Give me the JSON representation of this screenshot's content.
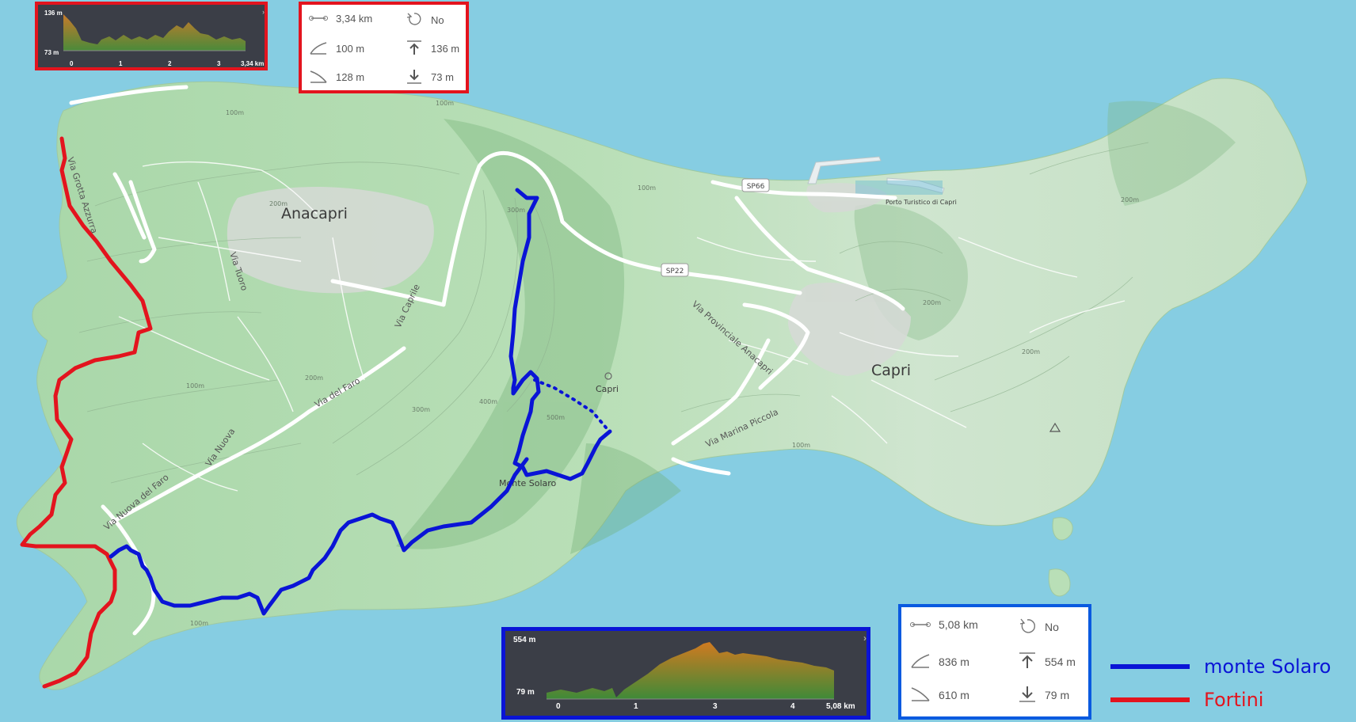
{
  "map": {
    "places": {
      "anacapri": "Anacapri",
      "capri_town": "Capri",
      "capri_peak": "Capri",
      "monte_solaro": "Monte Solaro",
      "porto": "Porto Turistico\ndi Capri"
    },
    "roads": {
      "grotta": "Via Grotta Azzurra",
      "tuoro": "Via Tuoro",
      "caprile": "Via Caprile",
      "faro": "Via del Faro",
      "nuova": "Via Nuova",
      "nuova_faro": "Via Nuova del Faro",
      "provinciale": "Via Provinciale Anacapri",
      "marina_piccola": "Via Marina Piccola",
      "sp66": "SP66",
      "sp22": "SP22"
    },
    "contours": {
      "c100": "100m",
      "c200": "200m",
      "c300": "300m",
      "c400": "400m",
      "c500": "500m",
      "c600": "600m"
    },
    "colors": {
      "sea": "#86cde2",
      "land": "#b8dcb8",
      "route_blue": "#0a14d6",
      "route_red": "#e3141e"
    }
  },
  "red_route": {
    "name": "Fortini",
    "profile": {
      "max_label": "136 m",
      "min_label": "73 m",
      "x_ticks": [
        "0",
        "1",
        "2",
        "3",
        "3,34 km"
      ]
    },
    "stats": {
      "distance": "3,34 km",
      "loop": "No",
      "ascent": "100 m",
      "max_elev": "136 m",
      "descent": "128 m",
      "min_elev": "73 m"
    }
  },
  "blue_route": {
    "name": "monte  Solaro",
    "profile": {
      "max_label": "554 m",
      "min_label": "79 m",
      "x_ticks": [
        "0",
        "1",
        "3",
        "4",
        "5,08 km"
      ]
    },
    "stats": {
      "distance": "5,08 km",
      "loop": "No",
      "ascent": "836 m",
      "max_elev": "554 m",
      "descent": "610 m",
      "min_elev": "79 m"
    }
  },
  "legend": [
    {
      "label": "monte  Solaro",
      "color": "#0a14d6"
    },
    {
      "label": "Fortini",
      "color": "#e3141e"
    }
  ]
}
